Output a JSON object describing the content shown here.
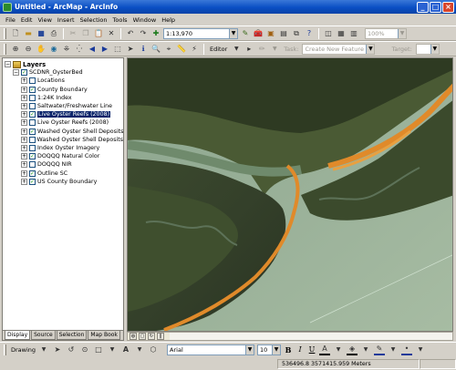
{
  "window": {
    "title": "Untitled - ArcMap - ArcInfo"
  },
  "menu": [
    "File",
    "Edit",
    "View",
    "Insert",
    "Selection",
    "Tools",
    "Window",
    "Help"
  ],
  "toolbar1": {
    "scale": "1:13,970",
    "zoom_percent": "100%"
  },
  "toolbar2": {
    "editor_label": "Editor",
    "task_label": "Task:",
    "task_value": "Create New Feature",
    "target_label": "Target:"
  },
  "toc": {
    "root": "Layers",
    "group": "SCDNR_OysterBed",
    "layers": [
      {
        "name": "Locations",
        "checked": false,
        "selected": false
      },
      {
        "name": "County Boundary",
        "checked": true,
        "selected": false
      },
      {
        "name": "1:24K Index",
        "checked": false,
        "selected": false
      },
      {
        "name": "Saltwater/Freshwater Line",
        "checked": false,
        "selected": false
      },
      {
        "name": "Live Oyster Reefs (2008)",
        "checked": true,
        "selected": true
      },
      {
        "name": "Live Oyster Reefs (2008)",
        "checked": false,
        "selected": false
      },
      {
        "name": "Washed Oyster Shell Deposits",
        "checked": true,
        "selected": false
      },
      {
        "name": "Washed Oyster Shell Deposits",
        "checked": false,
        "selected": false
      },
      {
        "name": "Index Oyster Imagery",
        "checked": false,
        "selected": false
      },
      {
        "name": "DOQQQ Natural Color",
        "checked": true,
        "selected": false
      },
      {
        "name": "DOQQQ NIR",
        "checked": false,
        "selected": false
      },
      {
        "name": "Outline SC",
        "checked": true,
        "selected": false
      },
      {
        "name": "US County Boundary",
        "checked": true,
        "selected": false
      }
    ],
    "tabs": [
      "Display",
      "Source",
      "Selection",
      "Map Book"
    ]
  },
  "drawing": {
    "label": "Drawing",
    "font": "Arial",
    "font_size": "10"
  },
  "status": {
    "coords": "536496.8  3571415.959 Meters"
  }
}
